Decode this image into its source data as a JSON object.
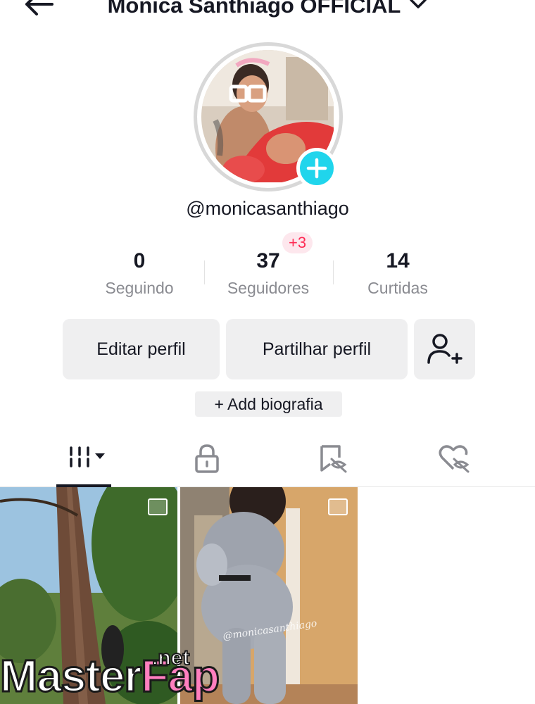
{
  "header": {
    "title": "Monica Santhiago OFFICIAL",
    "back_icon": "arrow-left-icon",
    "dropdown_icon": "chevron-down-icon"
  },
  "profile": {
    "handle": "@monicasanthiago",
    "add_icon": "plus-icon",
    "accent": "#20d5ec"
  },
  "stats": {
    "following": {
      "value": "0",
      "label": "Seguindo"
    },
    "followers": {
      "value": "37",
      "label": "Seguidores",
      "delta": "+3"
    },
    "likes": {
      "value": "14",
      "label": "Curtidas"
    }
  },
  "actions": {
    "edit": "Editar perfil",
    "share": "Partilhar perfil",
    "add_friend_icon": "add-user-icon"
  },
  "bio_button": "+ Add biografia",
  "tabs": [
    {
      "name": "videos",
      "icon": "grid-icon",
      "active": true
    },
    {
      "name": "private",
      "icon": "lock-icon",
      "active": false
    },
    {
      "name": "favorites",
      "icon": "bookmark-hidden-icon",
      "active": false
    },
    {
      "name": "liked",
      "icon": "heart-hidden-icon",
      "active": false
    }
  ],
  "posts": [
    {
      "type": "photo",
      "icon": "image-icon"
    },
    {
      "type": "photo",
      "icon": "image-icon",
      "overlay_text": "@monicasanthiago"
    }
  ],
  "watermark": {
    "left": "Master",
    "right": "Fap",
    "suffix": ".net"
  },
  "colors": {
    "primary_text": "#161823",
    "secondary_text": "#8a8b91",
    "button_bg": "#efeff0",
    "badge_red": "#fe2c55"
  }
}
